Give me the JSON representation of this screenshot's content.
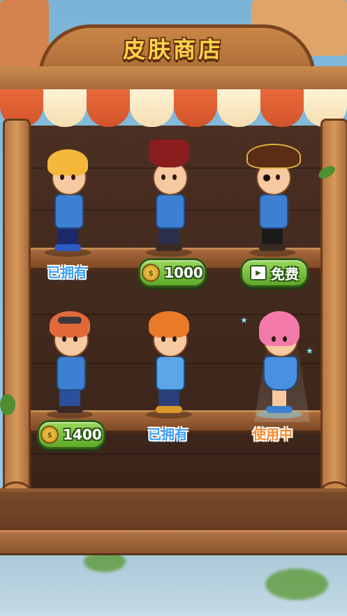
{
  "title": "皮肤商店",
  "colors": {
    "owned": "#3aa0ff",
    "in_use": "#ff8a2e",
    "button": "#5ea82a",
    "coin": "#f7d257"
  },
  "skins": [
    {
      "id": "archer",
      "state": "owned",
      "label": "已拥有"
    },
    {
      "id": "top-hat",
      "state": "buy",
      "price": "1000",
      "icon": "coin-icon"
    },
    {
      "id": "pirate",
      "state": "video",
      "label": "免费",
      "icon": "video-icon"
    },
    {
      "id": "goggles",
      "state": "buy",
      "price": "1400",
      "icon": "coin-icon"
    },
    {
      "id": "topknot",
      "state": "owned",
      "label": "已拥有"
    },
    {
      "id": "pink-girl",
      "state": "in_use",
      "label": "使用中"
    }
  ]
}
